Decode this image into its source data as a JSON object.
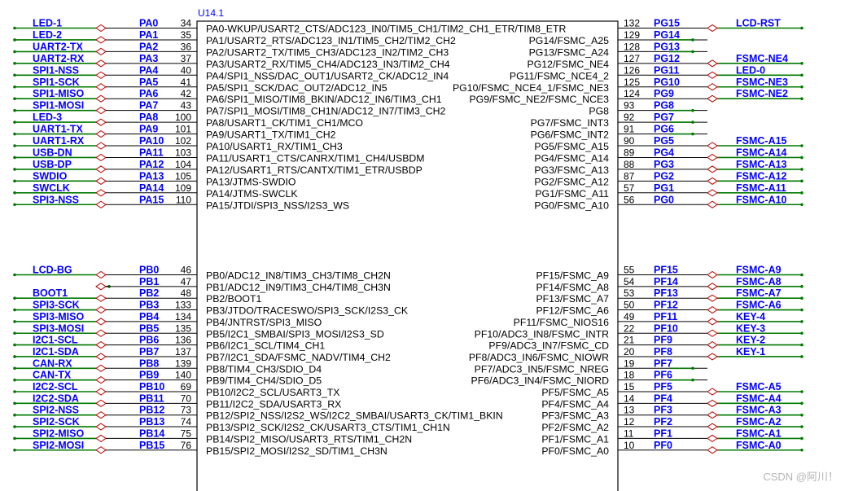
{
  "component": {
    "ref": "U14.1"
  },
  "watermark": "CSDN @阿川！",
  "left_pins": [
    {
      "net": "LED-1",
      "pin": "PA0",
      "num": "34",
      "func": "PA0-WKUP/USART2_CTS/ADC123_IN0/TIM5_CH1/TIM2_CH1_ETR/TIM8_ETR"
    },
    {
      "net": "LED-2",
      "pin": "PA1",
      "num": "35",
      "func": "PA1/USART2_RTS/ADC123_IN1/TIM5_CH2/TIM2_CH2"
    },
    {
      "net": "UART2-TX",
      "pin": "PA2",
      "num": "36",
      "func": "PA2/USART2_TX/TIM5_CH3/ADC123_IN2/TIM2_CH3"
    },
    {
      "net": "UART2-RX",
      "pin": "PA3",
      "num": "37",
      "func": "PA3/USART2_RX/TIM5_CH4/ADC123_IN3/TIM2_CH4"
    },
    {
      "net": "SPI1-NSS",
      "pin": "PA4",
      "num": "40",
      "func": "PA4/SPI1_NSS/DAC_OUT1/USART2_CK/ADC12_IN4"
    },
    {
      "net": "SPI1-SCK",
      "pin": "PA5",
      "num": "41",
      "func": "PA5/SPI1_SCK/DAC_OUT2/ADC12_IN5"
    },
    {
      "net": "SPI1-MISO",
      "pin": "PA6",
      "num": "42",
      "func": "PA6/SPI1_MISO/TIM8_BKIN/ADC12_IN6/TIM3_CH1"
    },
    {
      "net": "SPI1-MOSI",
      "pin": "PA7",
      "num": "43",
      "func": "PA7/SPI1_MOSI/TIM8_CH1N/ADC12_IN7/TIM3_CH2"
    },
    {
      "net": "LED-3",
      "pin": "PA8",
      "num": "100",
      "func": "PA8/USART1_CK/TIM1_CH1/MCO"
    },
    {
      "net": "UART1-TX",
      "pin": "PA9",
      "num": "101",
      "func": "PA9/USART1_TX/TIM1_CH2"
    },
    {
      "net": "UART1-RX",
      "pin": "PA10",
      "num": "102",
      "func": "PA10/USART1_RX/TIM1_CH3"
    },
    {
      "net": "USB-DN",
      "pin": "PA11",
      "num": "103",
      "func": "PA11/USART1_CTS/CANRX/TIM1_CH4/USBDM"
    },
    {
      "net": "USB-DP",
      "pin": "PA12",
      "num": "104",
      "func": "PA12/USART1_RTS/CANTX/TIM1_ETR/USBDP"
    },
    {
      "net": "SWDIO",
      "pin": "PA13",
      "num": "105",
      "func": "PA13/JTMS-SWDIO"
    },
    {
      "net": "SWCLK",
      "pin": "PA14",
      "num": "109",
      "func": "PA14/JTMS-SWCLK"
    },
    {
      "net": "SPI3-NSS",
      "pin": "PA15",
      "num": "110",
      "func": "PA15/JTDI/SPI3_NSS/I2S3_WS"
    },
    {
      "net": "LCD-BG",
      "pin": "PB0",
      "num": "46",
      "func": "PB0/ADC12_IN8/TIM3_CH3/TIM8_CH2N"
    },
    {
      "net": "",
      "pin": "PB1",
      "num": "47",
      "func": "PB1/ADC12_IN9/TIM3_CH4/TIM8_CH3N"
    },
    {
      "net": "BOOT1",
      "pin": "PB2",
      "num": "48",
      "func": "PB2/BOOT1"
    },
    {
      "net": "SPI3-SCK",
      "pin": "PB3",
      "num": "133",
      "func": "PB3/JTDO/TRACESWO/SPI3_SCK/I2S3_CK"
    },
    {
      "net": "SPI3-MISO",
      "pin": "PB4",
      "num": "134",
      "func": "PB4/JNTRST/SPI3_MISO"
    },
    {
      "net": "SPI3-MOSI",
      "pin": "PB5",
      "num": "135",
      "func": "PB5/I2C1_SMBAI/SPI3_MOSI/I2S3_SD"
    },
    {
      "net": "I2C1-SCL",
      "pin": "PB6",
      "num": "136",
      "func": "PB6/I2C1_SCL/TIM4_CH1"
    },
    {
      "net": "I2C1-SDA",
      "pin": "PB7",
      "num": "137",
      "func": "PB7/I2C1_SDA/FSMC_NADV/TIM4_CH2"
    },
    {
      "net": "CAN-RX",
      "pin": "PB8",
      "num": "139",
      "func": "PB8/TIM4_CH3/SDIO_D4"
    },
    {
      "net": "CAN-TX",
      "pin": "PB9",
      "num": "140",
      "func": "PB9/TIM4_CH4/SDIO_D5"
    },
    {
      "net": "I2C2-SCL",
      "pin": "PB10",
      "num": "69",
      "func": "PB10/I2C2_SCL/USART3_TX"
    },
    {
      "net": "I2C2-SDA",
      "pin": "PB11",
      "num": "70",
      "func": "PB11/I2C2_SDA/USART3_RX"
    },
    {
      "net": "SPI2-NSS",
      "pin": "PB12",
      "num": "73",
      "func": "PB12/SPI2_NSS/I2S2_WS/I2C2_SMBAI/USART3_CK/TIM1_BKIN"
    },
    {
      "net": "SPI2-SCK",
      "pin": "PB13",
      "num": "74",
      "func": "PB13/SPI2_SCK/I2S2_CK/USART3_CTS/TIM1_CH1N"
    },
    {
      "net": "SPI2-MISO",
      "pin": "PB14",
      "num": "75",
      "func": "PB14/SPI2_MISO/USART3_RTS/TIM1_CH2N"
    },
    {
      "net": "SPI2-MOSI",
      "pin": "PB15",
      "num": "76",
      "func": "PB15/SPI2_MOSI/I2S2_SD/TIM1_CH3N"
    }
  ],
  "right_pins": [
    {
      "net": "LCD-RST",
      "pin": "PG15",
      "num": "132",
      "func": ""
    },
    {
      "net": "",
      "pin": "PG14",
      "num": "129",
      "func": "PG14/FSMC_A25"
    },
    {
      "net": "",
      "pin": "PG13",
      "num": "128",
      "func": "PG13/FSMC_A24"
    },
    {
      "net": "FSMC-NE4",
      "pin": "PG12",
      "num": "127",
      "func": "PG12/FSMC_NE4"
    },
    {
      "net": "LED-0",
      "pin": "PG11",
      "num": "126",
      "func": "PG11/FSMC_NCE4_2"
    },
    {
      "net": "FSMC-NE3",
      "pin": "PG10",
      "num": "125",
      "func": "PG10/FSMC_NCE4_1/FSMC_NE3"
    },
    {
      "net": "FSMC-NE2",
      "pin": "PG9",
      "num": "124",
      "func": "PG9/FSMC_NE2/FSMC_NCE3"
    },
    {
      "net": "",
      "pin": "PG8",
      "num": "93",
      "func": "PG8"
    },
    {
      "net": "",
      "pin": "PG7",
      "num": "92",
      "func": "PG7/FSMC_INT3"
    },
    {
      "net": "",
      "pin": "PG6",
      "num": "91",
      "func": "PG6/FSMC_INT2"
    },
    {
      "net": "FSMC-A15",
      "pin": "PG5",
      "num": "90",
      "func": "PG5/FSMC_A15"
    },
    {
      "net": "FSMC-A14",
      "pin": "PG4",
      "num": "89",
      "func": "PG4/FSMC_A14"
    },
    {
      "net": "FSMC-A13",
      "pin": "PG3",
      "num": "88",
      "func": "PG3/FSMC_A13"
    },
    {
      "net": "FSMC-A12",
      "pin": "PG2",
      "num": "87",
      "func": "PG2/FSMC_A12"
    },
    {
      "net": "FSMC-A11",
      "pin": "PG1",
      "num": "57",
      "func": "PG1/FSMC_A11"
    },
    {
      "net": "FSMC-A10",
      "pin": "PG0",
      "num": "56",
      "func": "PG0/FSMC_A10"
    },
    {
      "net": "FSMC-A9",
      "pin": "PF15",
      "num": "55",
      "func": "PF15/FSMC_A9"
    },
    {
      "net": "FSMC-A8",
      "pin": "PF14",
      "num": "54",
      "func": "PF14/FSMC_A8"
    },
    {
      "net": "FSMC-A7",
      "pin": "PF13",
      "num": "53",
      "func": "PF13/FSMC_A7"
    },
    {
      "net": "FSMC-A6",
      "pin": "PF12",
      "num": "50",
      "func": "PF12/FSMC_A6"
    },
    {
      "net": "KEY-4",
      "pin": "PF11",
      "num": "49",
      "func": "PF11/FSMC_NIOS16"
    },
    {
      "net": "KEY-3",
      "pin": "PF10",
      "num": "22",
      "func": "PF10/ADC3_IN8/FSMC_INTR"
    },
    {
      "net": "KEY-2",
      "pin": "PF9",
      "num": "21",
      "func": "PF9/ADC3_IN7/FSMC_CD"
    },
    {
      "net": "KEY-1",
      "pin": "PF8",
      "num": "20",
      "func": "PF8/ADC3_IN6/FSMC_NIOWR"
    },
    {
      "net": "",
      "pin": "PF7",
      "num": "19",
      "func": "PF7/ADC3_IN5/FSMC_NREG"
    },
    {
      "net": "",
      "pin": "PF6",
      "num": "18",
      "func": "PF6/ADC3_IN4/FSMC_NIORD"
    },
    {
      "net": "FSMC-A5",
      "pin": "PF5",
      "num": "15",
      "func": "PF5/FSMC_A5"
    },
    {
      "net": "FSMC-A4",
      "pin": "PF4",
      "num": "14",
      "func": "PF4/FSMC_A4"
    },
    {
      "net": "FSMC-A3",
      "pin": "PF3",
      "num": "13",
      "func": "PF3/FSMC_A3"
    },
    {
      "net": "FSMC-A2",
      "pin": "PF2",
      "num": "12",
      "func": "PF2/FSMC_A2"
    },
    {
      "net": "FSMC-A1",
      "pin": "PF1",
      "num": "11",
      "func": "PF1/FSMC_A1"
    },
    {
      "net": "FSMC-A0",
      "pin": "PF0",
      "num": "10",
      "func": "PF0/FSMC_A0"
    }
  ],
  "colors": {
    "wire": "#007800",
    "net_label": "#0000ff",
    "port_marker": "#c00000",
    "pin_line": "#000000"
  }
}
